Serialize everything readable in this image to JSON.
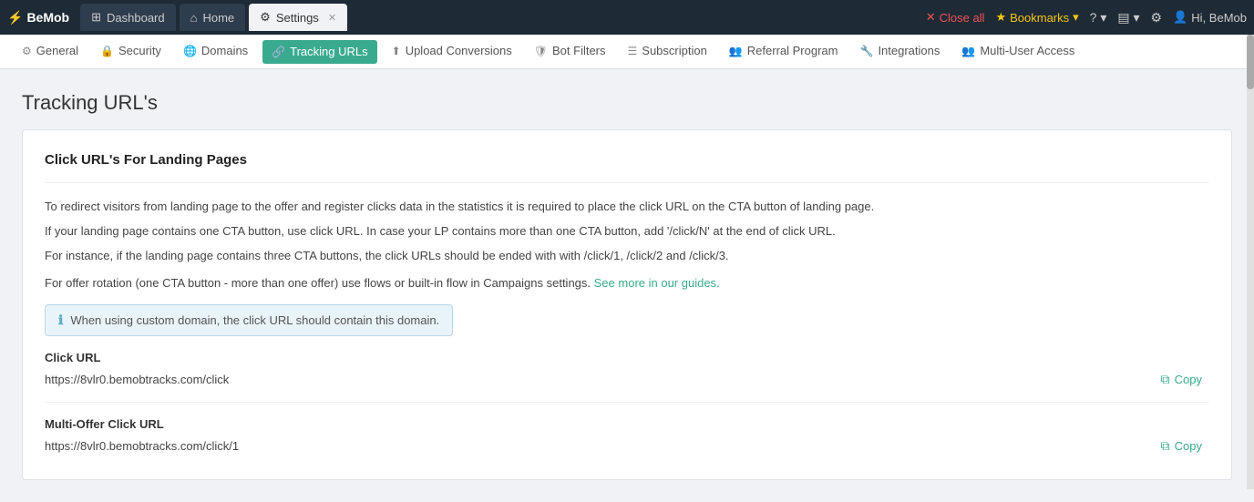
{
  "topbar": {
    "logo": "BeMob",
    "logo_icon": "⚡",
    "tabs": [
      {
        "label": "Dashboard",
        "icon": "⊞",
        "active": false,
        "closable": false
      },
      {
        "label": "Home",
        "icon": "⌂",
        "active": false,
        "closable": false
      },
      {
        "label": "Settings",
        "icon": "⚙",
        "active": true,
        "closable": true
      }
    ],
    "close_all": "Close all",
    "bookmarks": "Bookmarks",
    "help_icon": "?",
    "inbox_icon": "✉",
    "settings_icon": "⚙",
    "user": "Hi, BeMob"
  },
  "secondary_nav": {
    "items": [
      {
        "label": "General",
        "icon": "⚙",
        "active": false
      },
      {
        "label": "Security",
        "icon": "🔒",
        "active": false
      },
      {
        "label": "Domains",
        "icon": "🌐",
        "active": false
      },
      {
        "label": "Tracking URLs",
        "icon": "🔗",
        "active": true
      },
      {
        "label": "Upload Conversions",
        "icon": "⬆",
        "active": false
      },
      {
        "label": "Bot Filters",
        "icon": "🛡",
        "active": false
      },
      {
        "label": "Subscription",
        "icon": "☰",
        "active": false
      },
      {
        "label": "Referral Program",
        "icon": "👥",
        "active": false
      },
      {
        "label": "Integrations",
        "icon": "🔧",
        "active": false
      },
      {
        "label": "Multi-User Access",
        "icon": "👥",
        "active": false
      }
    ]
  },
  "page": {
    "title": "Tracking URL's",
    "card": {
      "section_title": "Click URL's For Landing Pages",
      "description_lines": [
        "To redirect visitors from landing page to the offer and register clicks data in the statistics it is required to place the click URL on the CTA button of landing page.",
        "If your landing page contains one CTA button, use click URL. In case your LP contains more than one CTA button, add '/click/N' at the end of click URL.",
        "For instance, if the landing page contains three CTA buttons, the click URLs should be ended with with /click/1, /click/2 and /click/3."
      ],
      "rotation_text": "For offer rotation (one CTA button - more than one offer) use flows or built-in flow in Campaigns settings.",
      "rotation_link": "See more in our guides.",
      "info_message": "When using custom domain, the click URL should contain this domain.",
      "click_url": {
        "label": "Click URL",
        "url": "https://8vlr0.bemobtracks.com/click",
        "copy_label": "Copy"
      },
      "multi_offer_url": {
        "label": "Multi-Offer Click URL",
        "url": "https://8vlr0.bemobtracks.com/click/1",
        "copy_label": "Copy"
      }
    }
  }
}
